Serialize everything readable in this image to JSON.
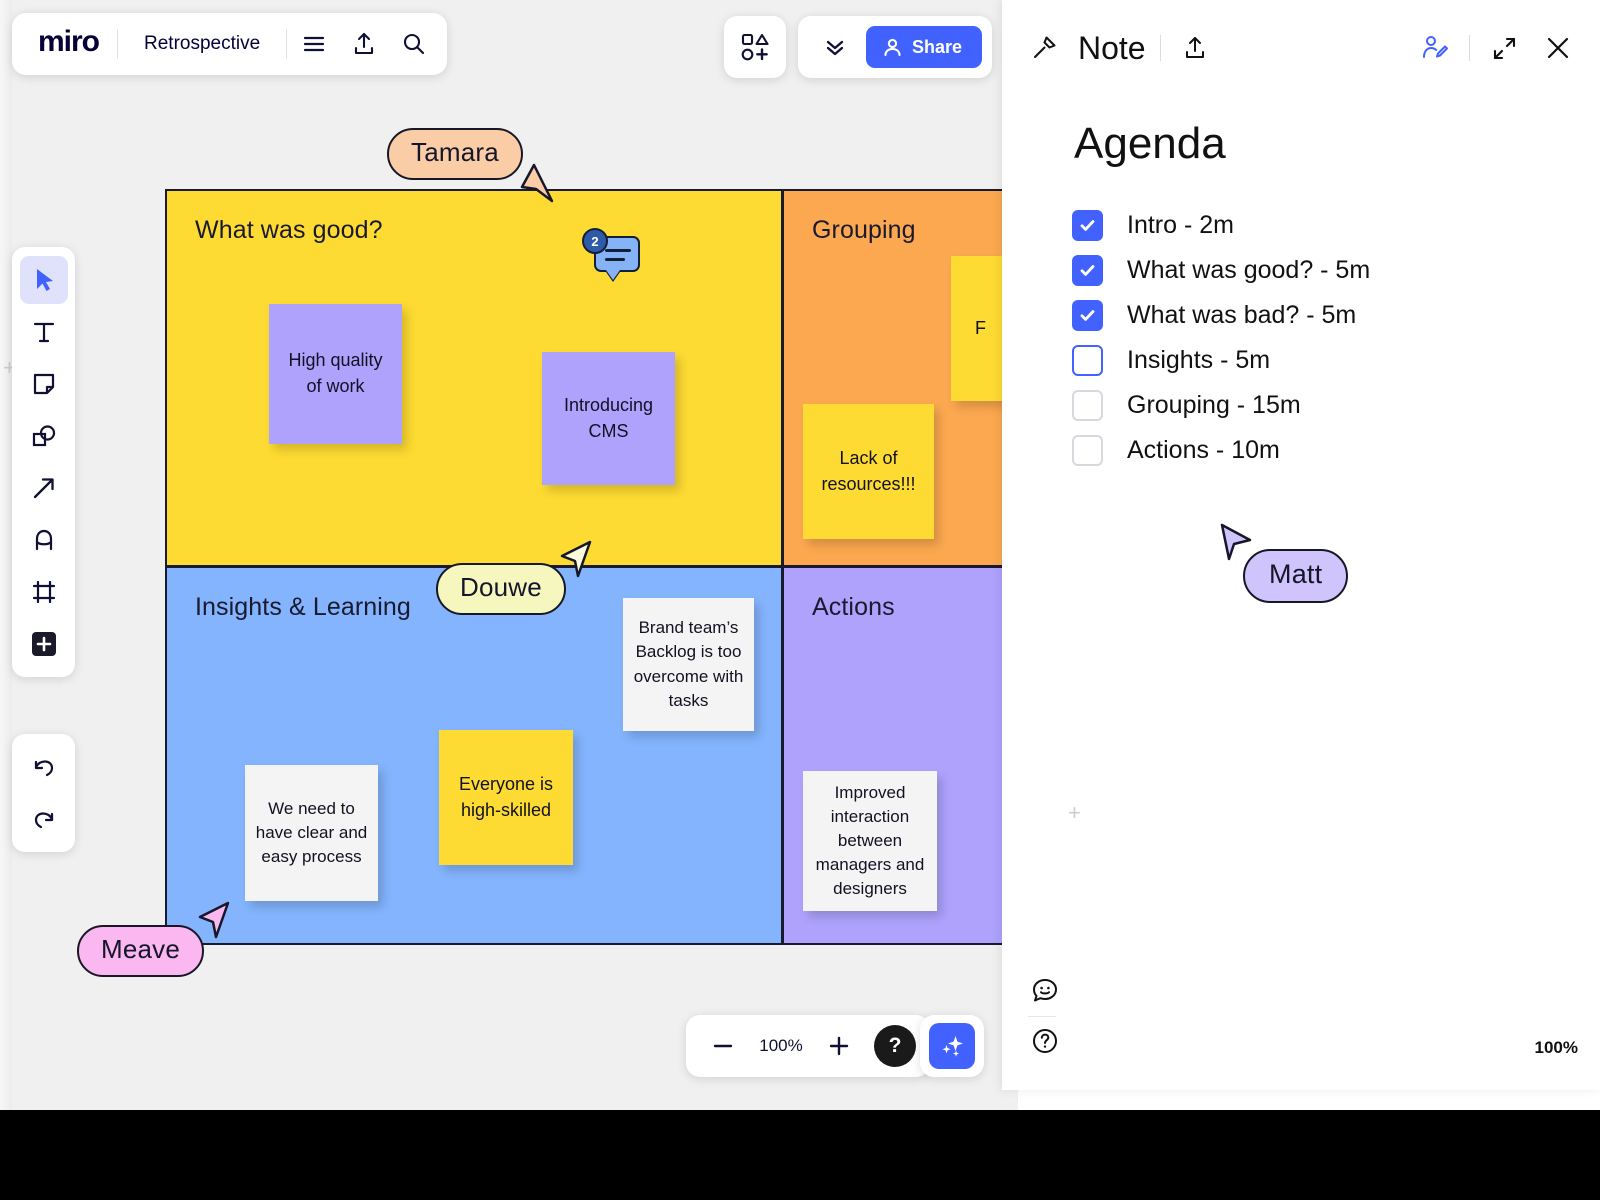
{
  "app": {
    "brand": "miro",
    "board_name": "Retrospective",
    "share_label": "Share",
    "zoom_level": "100%",
    "panel_zoom_level": "100%"
  },
  "toolbar_top": {
    "menu_icon": "hamburger-menu-icon",
    "upload_icon": "upload-icon",
    "search_icon": "search-icon",
    "shapes_icon": "shapes-icon",
    "collapse_icon": "double-chevron-down-icon",
    "share_icon": "person-icon"
  },
  "tool_rail": {
    "items": [
      {
        "name": "select-tool",
        "icon": "cursor-arrow-icon",
        "active": true
      },
      {
        "name": "text-tool",
        "icon": "text-t-icon",
        "active": false
      },
      {
        "name": "sticky-note-tool",
        "icon": "sticky-note-icon",
        "active": false
      },
      {
        "name": "shapes-tool",
        "icon": "shapes-overlap-icon",
        "active": false
      },
      {
        "name": "connector-tool",
        "icon": "arrow-diagonal-icon",
        "active": false
      },
      {
        "name": "pen-tool",
        "icon": "pen-icon",
        "active": false
      },
      {
        "name": "frame-tool",
        "icon": "frame-icon",
        "active": false
      },
      {
        "name": "more-apps-tool",
        "icon": "plus-square-icon",
        "active": false
      }
    ],
    "undo": {
      "name": "undo-button",
      "icon": "undo-arrow-icon"
    },
    "redo": {
      "name": "redo-button",
      "icon": "redo-arrow-icon"
    }
  },
  "zoom_bar": {
    "minus_icon": "minus-icon",
    "plus_icon": "plus-icon",
    "help_icon": "question-mark-icon",
    "ai_icon": "sparkles-icon"
  },
  "board": {
    "quadrants": [
      {
        "id": "good",
        "title": "What was good?",
        "color": "#FDDB32"
      },
      {
        "id": "grouping",
        "title": "Grouping",
        "color": "#FCA850"
      },
      {
        "id": "insights",
        "title": "Insights & Learning",
        "color": "#83B4FD"
      },
      {
        "id": "actions",
        "title": "Actions",
        "color": "#AEA2FD"
      }
    ],
    "stickies": [
      {
        "id": "n1",
        "text": "High quality of work",
        "color": "#AEA2FD"
      },
      {
        "id": "n2",
        "text": "Introducing CMS",
        "color": "#AEA2FD"
      },
      {
        "id": "n3",
        "text": "F",
        "color": "#FDDB32"
      },
      {
        "id": "n4",
        "text": "Lack of resources!!!",
        "color": "#FDDB32"
      },
      {
        "id": "n5",
        "text": "Brand team’s Backlog is too overcome with tasks",
        "color": "#f4f4f4"
      },
      {
        "id": "n6",
        "text": "Everyone is high-skilled",
        "color": "#FDDB32"
      },
      {
        "id": "n7",
        "text": "We need to have clear and easy process",
        "color": "#f4f4f4"
      },
      {
        "id": "n8",
        "text": "Improved interaction between managers and designers",
        "color": "#f4f4f4"
      }
    ],
    "comment_pin": {
      "count": "2",
      "icon": "comment-bubble-icon"
    },
    "cursors": [
      {
        "name": "Tamara",
        "color": "#FBCDA6"
      },
      {
        "name": "Douwe",
        "color": "#F5F7BE"
      },
      {
        "name": "Meave",
        "color": "#FBB8F0"
      },
      {
        "name": "Matt",
        "color": "#CFC4FB"
      }
    ]
  },
  "note_panel": {
    "title": "Note",
    "pin_icon": "pin-icon",
    "share_note_icon": "upload-icon",
    "collaborate_icon": "person-edit-icon",
    "expand_icon": "expand-diagonal-icon",
    "close_icon": "close-x-icon",
    "heading": "Agenda",
    "agenda": [
      {
        "label": "Intro - 2m",
        "checked": true,
        "focused": false
      },
      {
        "label": "What was good? - 5m",
        "checked": true,
        "focused": false
      },
      {
        "label": "What was bad? - 5m",
        "checked": true,
        "focused": false
      },
      {
        "label": "Insights - 5m",
        "checked": false,
        "focused": true
      },
      {
        "label": "Grouping - 15m",
        "checked": false,
        "focused": false
      },
      {
        "label": "Actions - 10m",
        "checked": false,
        "focused": false
      }
    ],
    "feedback_icon": "smiley-chat-icon",
    "help_icon": "question-circle-icon"
  }
}
